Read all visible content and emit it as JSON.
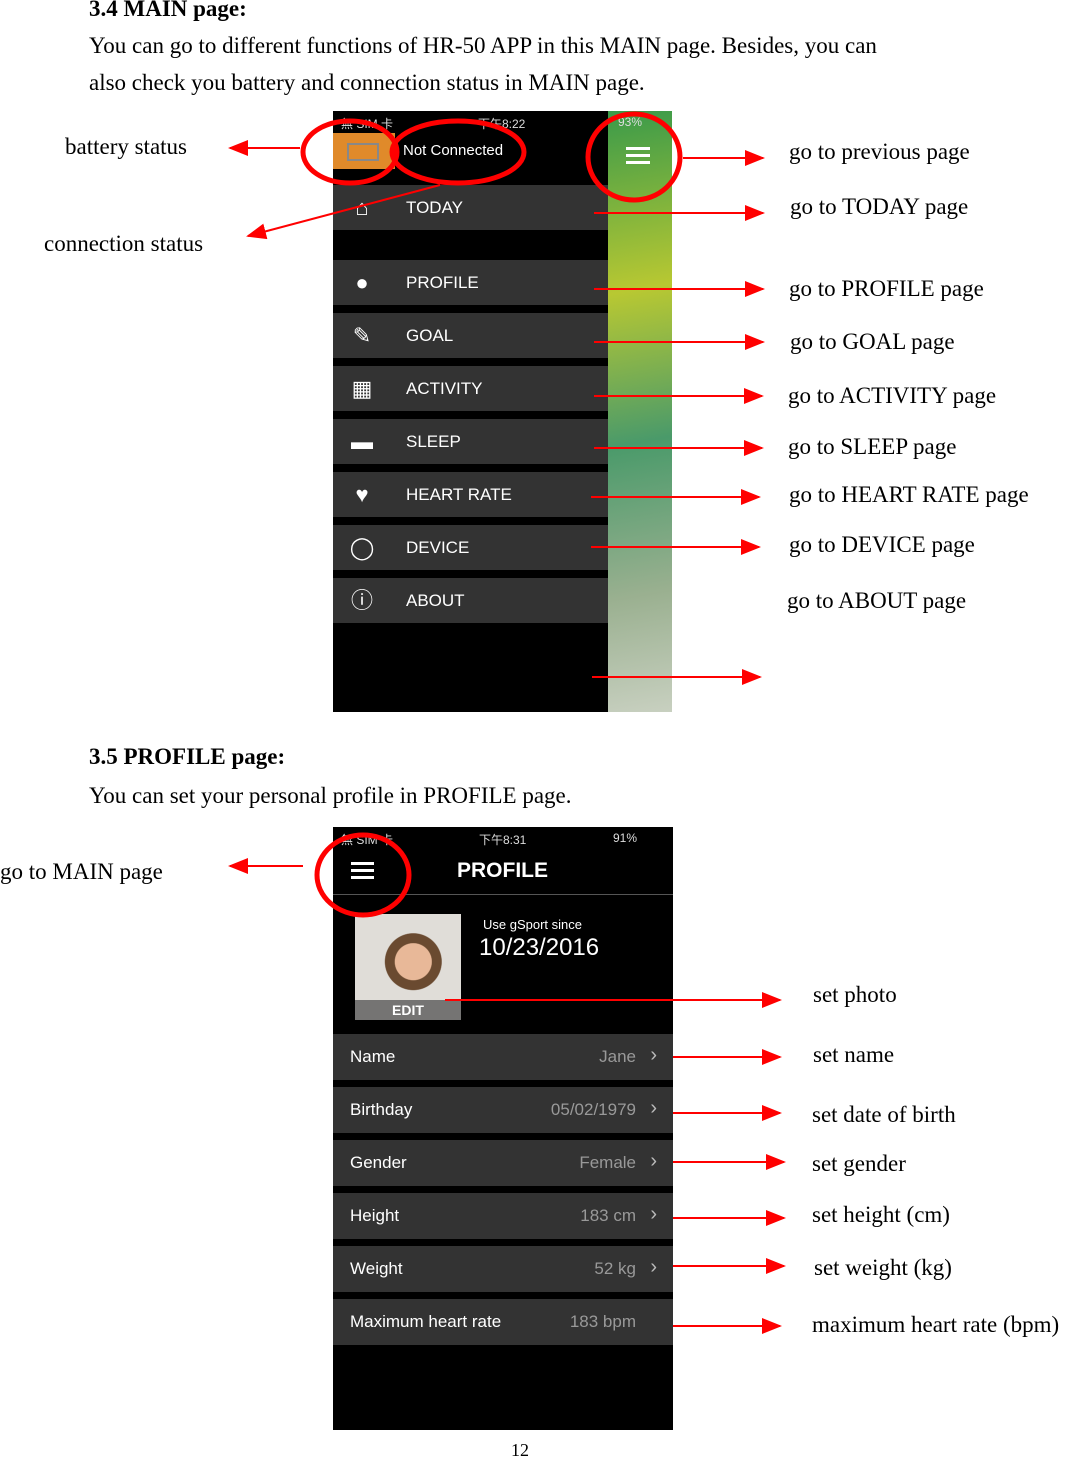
{
  "section1": {
    "heading": "3.4 MAIN page:",
    "line1": "You can go to different functions of HR-50 APP in this MAIN page. Besides, you can",
    "line2": "also check you battery and connection status in MAIN page."
  },
  "main_screen": {
    "status_carrier": "無 SIM 卡",
    "status_time": "下午8:22",
    "status_battery": "93%",
    "connection": "Not Connected",
    "menu": [
      {
        "label": "TODAY",
        "icon": "home-icon"
      },
      {
        "label": "PROFILE",
        "icon": "person-icon"
      },
      {
        "label": "GOAL",
        "icon": "goal-icon"
      },
      {
        "label": "ACTIVITY",
        "icon": "calendar-icon"
      },
      {
        "label": "SLEEP",
        "icon": "bed-icon"
      },
      {
        "label": "HEART RATE",
        "icon": "heart-icon"
      },
      {
        "label": "DEVICE",
        "icon": "band-icon"
      },
      {
        "label": "ABOUT",
        "icon": "info-icon"
      }
    ]
  },
  "annotations1": {
    "battery": "battery status",
    "connection": "connection status",
    "previous": "go to previous page",
    "today": "go to TODAY page",
    "profile": "go to PROFILE page",
    "goal": "go to GOAL page",
    "activity": "go to ACTIVITY page",
    "sleep": "go to SLEEP page",
    "heart": "go to HEART RATE page",
    "device": "go to DEVICE page",
    "about": "go to ABOUT page"
  },
  "section2": {
    "heading": "3.5 PROFILE page:",
    "line1": "You can set your personal profile in PROFILE page."
  },
  "profile_screen": {
    "status_carrier": "無 SIM 卡",
    "status_time": "下午8:31",
    "status_battery": "91%",
    "title": "PROFILE",
    "since_label": "Use gSport since",
    "since_date": "10/23/2016",
    "edit": "EDIT",
    "rows": [
      {
        "key": "Name",
        "value": "Jane"
      },
      {
        "key": "Birthday",
        "value": "05/02/1979"
      },
      {
        "key": "Gender",
        "value": "Female"
      },
      {
        "key": "Height",
        "value": "183 cm"
      },
      {
        "key": "Weight",
        "value": "52 kg"
      },
      {
        "key": "Maximum heart rate",
        "value": "183 bpm"
      }
    ]
  },
  "annotations2": {
    "main": "go to MAIN page",
    "photo": "set photo",
    "name": "set name",
    "birth": "set date of birth",
    "gender": "set gender",
    "height": "set height (cm)",
    "weight": "set weight (kg)",
    "maxhr": "maximum heart rate (bpm)"
  },
  "page_number": "12",
  "colors": {
    "annotation": "#ff0000",
    "battery_box": "#e08a2a",
    "menu_row": "#333333"
  }
}
